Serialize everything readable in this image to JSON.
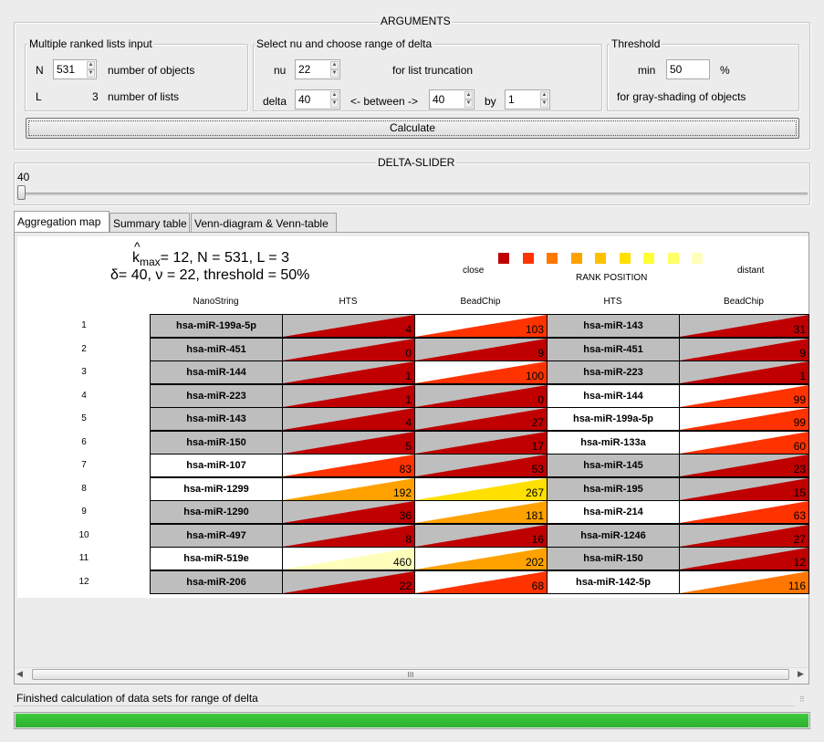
{
  "arguments": {
    "title": "ARGUMENTS",
    "multi": {
      "title": "Multiple ranked lists input",
      "n_label": "N",
      "n_value": "531",
      "n_desc": "number of objects",
      "l_label": "L",
      "l_value": "3",
      "l_desc": "number of lists"
    },
    "nu": {
      "title": "Select nu and choose range of delta",
      "nu_label": "nu",
      "nu_value": "22",
      "nu_desc": "for list truncation",
      "delta_label": "delta",
      "delta_value": "40",
      "between_label": "<- between ->",
      "between_value": "40",
      "by_label": "by",
      "by_value": "1"
    },
    "threshold": {
      "title": "Threshold",
      "min_label": "min",
      "min_value": "50",
      "unit": "%",
      "desc": "for gray-shading of objects"
    },
    "calculate_label": "Calculate"
  },
  "slider": {
    "title": "DELTA-SLIDER",
    "value_text": "40",
    "position": 0
  },
  "tabs": [
    "Aggregation map",
    "Summary table",
    "Venn-diagram & Venn-table"
  ],
  "map": {
    "k_hat": "^",
    "k_letter": "k",
    "k_sub": "max",
    "k_rest": "= 12, N = 531, L = 3",
    "line2": "δ= 40, ν = 22, threshold = 50%",
    "legend_close": "close",
    "legend_distant": "distant",
    "legend_title": "RANK POSITION",
    "legend_colors": [
      "#c00000",
      "#ff3300",
      "#ff7700",
      "#ffa200",
      "#ffc000",
      "#ffe000",
      "#ffff33",
      "#ffff66",
      "#ffffbb"
    ],
    "columns": [
      "NanoString",
      "HTS",
      "BeadChip",
      "HTS",
      "BeadChip"
    ],
    "column_types": [
      "name",
      "rank",
      "rank",
      "name",
      "rank"
    ],
    "rows": [
      {
        "n": "1",
        "c": [
          {
            "t": "hsa-miR-199a-5p",
            "g": true
          },
          {
            "t": "4",
            "g": true,
            "col": "#c00000"
          },
          {
            "t": "103",
            "g": false,
            "col": "#ff3300"
          },
          {
            "t": "hsa-miR-143",
            "g": true
          },
          {
            "t": "31",
            "g": true,
            "col": "#c00000"
          }
        ]
      },
      {
        "n": "2",
        "c": [
          {
            "t": "hsa-miR-451",
            "g": true
          },
          {
            "t": "0",
            "g": true,
            "col": "#c00000"
          },
          {
            "t": "9",
            "g": true,
            "col": "#c00000"
          },
          {
            "t": "hsa-miR-451",
            "g": true
          },
          {
            "t": "9",
            "g": true,
            "col": "#c00000"
          }
        ]
      },
      {
        "n": "3",
        "c": [
          {
            "t": "hsa-miR-144",
            "g": true
          },
          {
            "t": "1",
            "g": true,
            "col": "#c00000"
          },
          {
            "t": "100",
            "g": false,
            "col": "#ff3300"
          },
          {
            "t": "hsa-miR-223",
            "g": true
          },
          {
            "t": "1",
            "g": true,
            "col": "#c00000"
          }
        ]
      },
      {
        "n": "4",
        "c": [
          {
            "t": "hsa-miR-223",
            "g": true
          },
          {
            "t": "1",
            "g": true,
            "col": "#c00000"
          },
          {
            "t": "0",
            "g": true,
            "col": "#c00000"
          },
          {
            "t": "hsa-miR-144",
            "g": false
          },
          {
            "t": "99",
            "g": false,
            "col": "#ff3300"
          }
        ]
      },
      {
        "n": "5",
        "c": [
          {
            "t": "hsa-miR-143",
            "g": true
          },
          {
            "t": "4",
            "g": true,
            "col": "#c00000"
          },
          {
            "t": "27",
            "g": true,
            "col": "#c00000"
          },
          {
            "t": "hsa-miR-199a-5p",
            "g": false
          },
          {
            "t": "99",
            "g": false,
            "col": "#ff3300"
          }
        ]
      },
      {
        "n": "6",
        "c": [
          {
            "t": "hsa-miR-150",
            "g": true
          },
          {
            "t": "5",
            "g": true,
            "col": "#c00000"
          },
          {
            "t": "17",
            "g": true,
            "col": "#c00000"
          },
          {
            "t": "hsa-miR-133a",
            "g": false
          },
          {
            "t": "60",
            "g": false,
            "col": "#ff3300"
          }
        ]
      },
      {
        "n": "7",
        "c": [
          {
            "t": "hsa-miR-107",
            "g": false
          },
          {
            "t": "83",
            "g": false,
            "col": "#ff3300"
          },
          {
            "t": "53",
            "g": true,
            "col": "#c00000"
          },
          {
            "t": "hsa-miR-145",
            "g": true
          },
          {
            "t": "23",
            "g": true,
            "col": "#c00000"
          }
        ]
      },
      {
        "n": "8",
        "c": [
          {
            "t": "hsa-miR-1299",
            "g": false
          },
          {
            "t": "192",
            "g": false,
            "col": "#ffa200"
          },
          {
            "t": "267",
            "g": false,
            "col": "#ffe000"
          },
          {
            "t": "hsa-miR-195",
            "g": true
          },
          {
            "t": "15",
            "g": true,
            "col": "#c00000"
          }
        ]
      },
      {
        "n": "9",
        "c": [
          {
            "t": "hsa-miR-1290",
            "g": true
          },
          {
            "t": "36",
            "g": true,
            "col": "#c00000"
          },
          {
            "t": "181",
            "g": false,
            "col": "#ffa200"
          },
          {
            "t": "hsa-miR-214",
            "g": false
          },
          {
            "t": "63",
            "g": false,
            "col": "#ff3300"
          }
        ]
      },
      {
        "n": "10",
        "c": [
          {
            "t": "hsa-miR-497",
            "g": true
          },
          {
            "t": "8",
            "g": true,
            "col": "#c00000"
          },
          {
            "t": "16",
            "g": true,
            "col": "#c00000"
          },
          {
            "t": "hsa-miR-1246",
            "g": true
          },
          {
            "t": "27",
            "g": true,
            "col": "#c00000"
          }
        ]
      },
      {
        "n": "11",
        "c": [
          {
            "t": "hsa-miR-519e",
            "g": false
          },
          {
            "t": "460",
            "g": false,
            "col": "#ffffbb"
          },
          {
            "t": "202",
            "g": false,
            "col": "#ffa200"
          },
          {
            "t": "hsa-miR-150",
            "g": true
          },
          {
            "t": "12",
            "g": true,
            "col": "#c00000"
          }
        ]
      },
      {
        "n": "12",
        "c": [
          {
            "t": "hsa-miR-206",
            "g": true
          },
          {
            "t": "22",
            "g": true,
            "col": "#c00000"
          },
          {
            "t": "68",
            "g": false,
            "col": "#ff3300"
          },
          {
            "t": "hsa-miR-142-5p",
            "g": false
          },
          {
            "t": "116",
            "g": false,
            "col": "#ff7700"
          }
        ]
      }
    ]
  },
  "hscroll": {
    "thumb_glyph": "III"
  },
  "status": {
    "text": "Finished calculation of data sets for range of delta",
    "progress": 1.0,
    "progress_color": "#3ecb3e"
  }
}
